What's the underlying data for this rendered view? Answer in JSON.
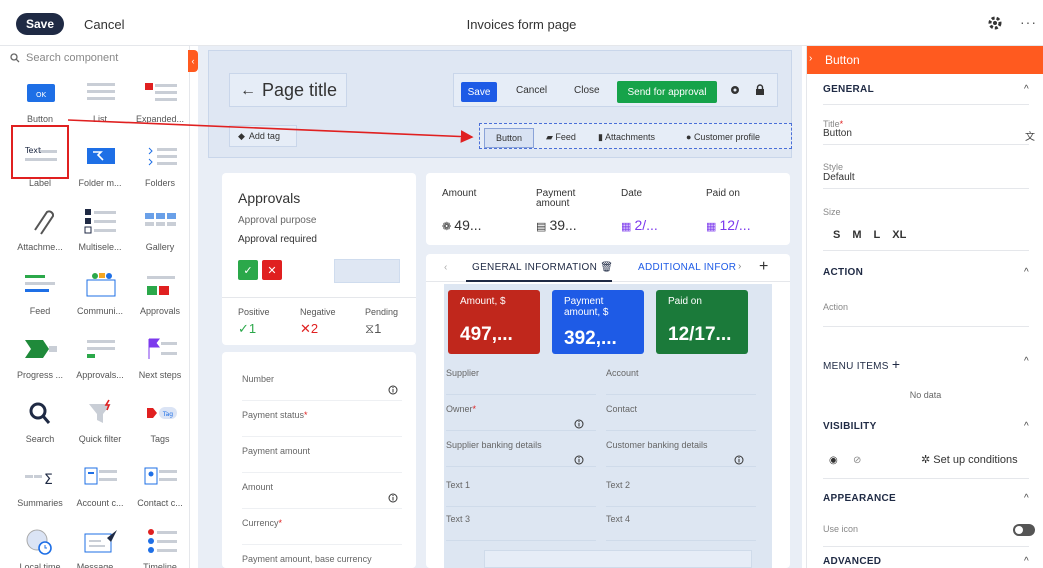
{
  "topbar": {
    "save_label": "Save",
    "cancel_label": "Cancel",
    "title": "Invoices form page"
  },
  "left": {
    "search_placeholder": "Search component",
    "components": [
      {
        "label": "Button",
        "icon": "ok-button-icon",
        "icon_text": "OK"
      },
      {
        "label": "List",
        "icon": "list-icon"
      },
      {
        "label": "Expanded...",
        "icon": "expanded-list-icon"
      },
      {
        "label": "Label",
        "icon": "label-icon",
        "icon_text": "Text"
      },
      {
        "label": "Folder m...",
        "icon": "folder-menu-icon"
      },
      {
        "label": "Folders",
        "icon": "folders-icon"
      },
      {
        "label": "Attachme...",
        "icon": "attachment-icon"
      },
      {
        "label": "Multisele...",
        "icon": "multiselect-icon"
      },
      {
        "label": "Gallery",
        "icon": "gallery-icon"
      },
      {
        "label": "Feed",
        "icon": "feed-icon"
      },
      {
        "label": "Communi...",
        "icon": "communication-icon"
      },
      {
        "label": "Approvals",
        "icon": "approvals-icon"
      },
      {
        "label": "Progress ...",
        "icon": "progress-icon"
      },
      {
        "label": "Approvals...",
        "icon": "approvals-list-icon"
      },
      {
        "label": "Next steps",
        "icon": "next-steps-icon"
      },
      {
        "label": "Search",
        "icon": "search-icon"
      },
      {
        "label": "Quick filter",
        "icon": "quick-filter-icon"
      },
      {
        "label": "Tags",
        "icon": "tags-icon",
        "icon_text": "Tag"
      },
      {
        "label": "Summaries",
        "icon": "summaries-icon"
      },
      {
        "label": "Account c...",
        "icon": "account-compact-icon"
      },
      {
        "label": "Contact c...",
        "icon": "contact-compact-icon"
      },
      {
        "label": "Local time",
        "icon": "local-time-icon"
      },
      {
        "label": "Message ...",
        "icon": "message-icon"
      },
      {
        "label": "Timeline",
        "icon": "timeline-icon"
      }
    ]
  },
  "canvas": {
    "page_title": "Page title",
    "toolbar": {
      "save": "Save",
      "cancel": "Cancel",
      "close": "Close",
      "send": "Send for approval"
    },
    "add_tag": "Add tag",
    "tabs": {
      "button": "Button",
      "feed": "Feed",
      "attachments": "Attachments",
      "customer_profile": "Customer profile"
    },
    "approvals": {
      "title": "Approvals",
      "purpose": "Approval purpose",
      "required": "Approval required",
      "ok_mark": "✓",
      "x_mark": "✕",
      "positive_label": "Positive",
      "positive_value": "✓1",
      "negative_label": "Negative",
      "negative_value": "✕2",
      "pending_label": "Pending",
      "pending_value": "⧖1"
    },
    "fields": [
      {
        "label": "Number",
        "required": false,
        "info": true
      },
      {
        "label": "Payment status",
        "required": true,
        "info": false
      },
      {
        "label": "Payment amount",
        "required": false,
        "info": false
      },
      {
        "label": "Amount",
        "required": false,
        "info": true
      },
      {
        "label": "Currency",
        "required": true,
        "info": false
      },
      {
        "label": "Payment amount, base currency",
        "required": false,
        "info": false
      }
    ],
    "summary": [
      {
        "label": "Amount",
        "value": "49...",
        "icon_glyph": "❁",
        "color": "#333333"
      },
      {
        "label": "Payment amount",
        "value": "39...",
        "icon_glyph": "▤",
        "color": "#333333"
      },
      {
        "label": "Date",
        "value": "2/...",
        "icon_glyph": "▦",
        "color": "#7c3aed"
      },
      {
        "label": "Paid on",
        "value": "12/...",
        "icon_glyph": "▦",
        "color": "#7c3aed"
      }
    ],
    "general_tab": "GENERAL INFORMATION",
    "additional_tab": "ADDITIONAL INFOR",
    "tiles": [
      {
        "label": "Amount, $",
        "value": "497,...",
        "color": "#c0271c"
      },
      {
        "label": "Payment amount, $",
        "value": "392,...",
        "color": "#1e5be6"
      },
      {
        "label": "Paid on",
        "value": "12/17...",
        "color": "#1b7a3a"
      }
    ],
    "general_fields": [
      {
        "label": "Supplier",
        "required": false,
        "info": false
      },
      {
        "label": "Account",
        "required": false,
        "info": false
      },
      {
        "label": "Owner",
        "required": true,
        "info": true
      },
      {
        "label": "Contact",
        "required": false,
        "info": false
      },
      {
        "label": "Supplier banking details",
        "required": false,
        "info": true
      },
      {
        "label": "Customer banking details",
        "required": false,
        "info": true
      },
      {
        "label": "Text 1",
        "required": false,
        "info": false
      },
      {
        "label": "Text 2",
        "required": false,
        "info": false
      },
      {
        "label": "Text 3",
        "required": false,
        "info": false
      },
      {
        "label": "Text 4",
        "required": false,
        "info": false
      }
    ]
  },
  "right": {
    "header": "Button",
    "general": "GENERAL",
    "title_label": "Title",
    "title_value": "Button",
    "style_label": "Style",
    "style_value": "Default",
    "size_label": "Size",
    "sizes": [
      "S",
      "M",
      "L",
      "XL"
    ],
    "action": "ACTION",
    "action_label": "Action",
    "menu_items": "MENU ITEMS",
    "no_data": "No data",
    "visibility": "VISIBILITY",
    "set_up_conditions": "Set up conditions",
    "appearance": "APPEARANCE",
    "use_icon": "Use icon",
    "advanced": "ADVANCED"
  },
  "colors": {
    "accent": "#ff5a1f",
    "primary": "#1e5be6",
    "dark": "#1f2a44",
    "success": "#16a34a",
    "danger": "#e02020"
  }
}
